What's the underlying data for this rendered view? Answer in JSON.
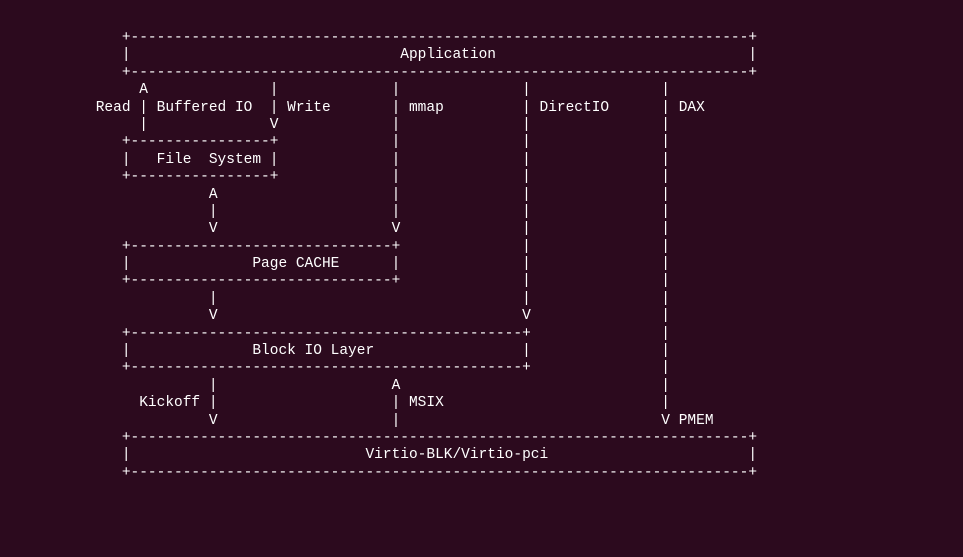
{
  "diagram": {
    "lines": [
      "              +-----------------------------------------------------------------------+",
      "              |                               Application                             |",
      "              +-----------------------------------------------------------------------+",
      "                A              |             |              |               |",
      "           Read | Buffered IO  | Write       | mmap         | DirectIO      | DAX",
      "                |              V             |              |               |",
      "              +----------------+             |              |               |",
      "              |   File  System |             |              |               |",
      "              +----------------+             |              |               |",
      "                        A                    |              |               |",
      "                        |                    |              |               |",
      "                        V                    V              |               |",
      "              +------------------------------+              |               |",
      "              |              Page CACHE      |              |               |",
      "              +------------------------------+              |               |",
      "                        |                                   |               |",
      "                        V                                   V               |",
      "              +---------------------------------------------+               |",
      "              |              Block IO Layer                 |               |",
      "              +---------------------------------------------+               |",
      "                        |                    A                              |",
      "                Kickoff |                    | MSIX                         |",
      "                        V                    |                              V PMEM",
      "              +-----------------------------------------------------------------------+",
      "              |                           Virtio-BLK/Virtio-pci                       |",
      "              +-----------------------------------------------------------------------+"
    ]
  },
  "labels": {
    "application": "Application",
    "read": "Read",
    "bufferedIO": "Buffered IO",
    "write": "Write",
    "mmap": "mmap",
    "directIO": "DirectIO",
    "dax": "DAX",
    "fileSystem": "File  System",
    "pageCache": "Page CACHE",
    "blockIOLayer": "Block IO Layer",
    "kickoff": "Kickoff",
    "msix": "MSIX",
    "pmem": "PMEM",
    "virtioBLK": "Virtio-BLK/Virtio-pci"
  }
}
